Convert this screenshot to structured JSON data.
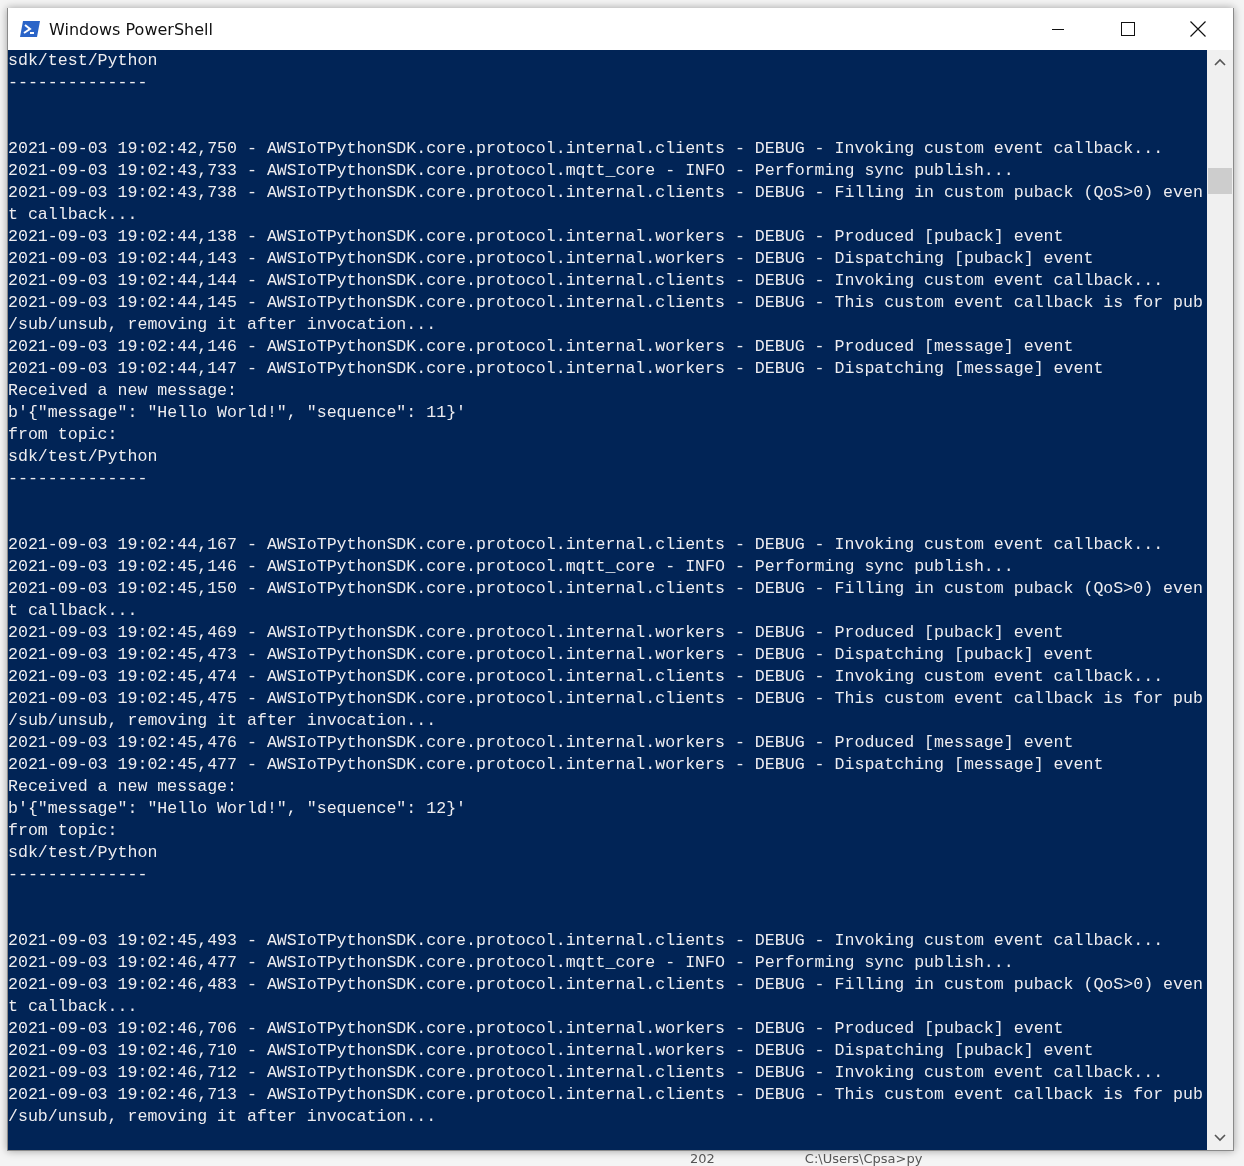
{
  "window": {
    "title": "Windows PowerShell"
  },
  "console": {
    "blocks": [
      [
        "sdk/test/Python",
        "--------------"
      ],
      [
        "2021-09-03 19:02:42,750 - AWSIoTPythonSDK.core.protocol.internal.clients - DEBUG - Invoking custom event callback...",
        "2021-09-03 19:02:43,733 - AWSIoTPythonSDK.core.protocol.mqtt_core - INFO - Performing sync publish...",
        "2021-09-03 19:02:43,738 - AWSIoTPythonSDK.core.protocol.internal.clients - DEBUG - Filling in custom puback (QoS>0) even",
        "t callback...",
        "2021-09-03 19:02:44,138 - AWSIoTPythonSDK.core.protocol.internal.workers - DEBUG - Produced [puback] event",
        "2021-09-03 19:02:44,143 - AWSIoTPythonSDK.core.protocol.internal.workers - DEBUG - Dispatching [puback] event",
        "2021-09-03 19:02:44,144 - AWSIoTPythonSDK.core.protocol.internal.clients - DEBUG - Invoking custom event callback...",
        "2021-09-03 19:02:44,145 - AWSIoTPythonSDK.core.protocol.internal.clients - DEBUG - This custom event callback is for pub",
        "/sub/unsub, removing it after invocation...",
        "2021-09-03 19:02:44,146 - AWSIoTPythonSDK.core.protocol.internal.workers - DEBUG - Produced [message] event",
        "2021-09-03 19:02:44,147 - AWSIoTPythonSDK.core.protocol.internal.workers - DEBUG - Dispatching [message] event",
        "Received a new message:",
        "b'{\"message\": \"Hello World!\", \"sequence\": 11}'",
        "from topic:",
        "sdk/test/Python",
        "--------------"
      ],
      [
        "2021-09-03 19:02:44,167 - AWSIoTPythonSDK.core.protocol.internal.clients - DEBUG - Invoking custom event callback...",
        "2021-09-03 19:02:45,146 - AWSIoTPythonSDK.core.protocol.mqtt_core - INFO - Performing sync publish...",
        "2021-09-03 19:02:45,150 - AWSIoTPythonSDK.core.protocol.internal.clients - DEBUG - Filling in custom puback (QoS>0) even",
        "t callback...",
        "2021-09-03 19:02:45,469 - AWSIoTPythonSDK.core.protocol.internal.workers - DEBUG - Produced [puback] event",
        "2021-09-03 19:02:45,473 - AWSIoTPythonSDK.core.protocol.internal.workers - DEBUG - Dispatching [puback] event",
        "2021-09-03 19:02:45,474 - AWSIoTPythonSDK.core.protocol.internal.clients - DEBUG - Invoking custom event callback...",
        "2021-09-03 19:02:45,475 - AWSIoTPythonSDK.core.protocol.internal.clients - DEBUG - This custom event callback is for pub",
        "/sub/unsub, removing it after invocation...",
        "2021-09-03 19:02:45,476 - AWSIoTPythonSDK.core.protocol.internal.workers - DEBUG - Produced [message] event",
        "2021-09-03 19:02:45,477 - AWSIoTPythonSDK.core.protocol.internal.workers - DEBUG - Dispatching [message] event",
        "Received a new message:",
        "b'{\"message\": \"Hello World!\", \"sequence\": 12}'",
        "from topic:",
        "sdk/test/Python",
        "--------------"
      ],
      [
        "2021-09-03 19:02:45,493 - AWSIoTPythonSDK.core.protocol.internal.clients - DEBUG - Invoking custom event callback...",
        "2021-09-03 19:02:46,477 - AWSIoTPythonSDK.core.protocol.mqtt_core - INFO - Performing sync publish...",
        "2021-09-03 19:02:46,483 - AWSIoTPythonSDK.core.protocol.internal.clients - DEBUG - Filling in custom puback (QoS>0) even",
        "t callback...",
        "2021-09-03 19:02:46,706 - AWSIoTPythonSDK.core.protocol.internal.workers - DEBUG - Produced [puback] event",
        "2021-09-03 19:02:46,710 - AWSIoTPythonSDK.core.protocol.internal.workers - DEBUG - Dispatching [puback] event",
        "2021-09-03 19:02:46,712 - AWSIoTPythonSDK.core.protocol.internal.clients - DEBUG - Invoking custom event callback...",
        "2021-09-03 19:02:46,713 - AWSIoTPythonSDK.core.protocol.internal.clients - DEBUG - This custom event callback is for pub",
        "/sub/unsub, removing it after invocation..."
      ]
    ]
  },
  "background": {
    "texts": [
      "202",
      "C:\\Users\\Cpsa>py"
    ]
  }
}
